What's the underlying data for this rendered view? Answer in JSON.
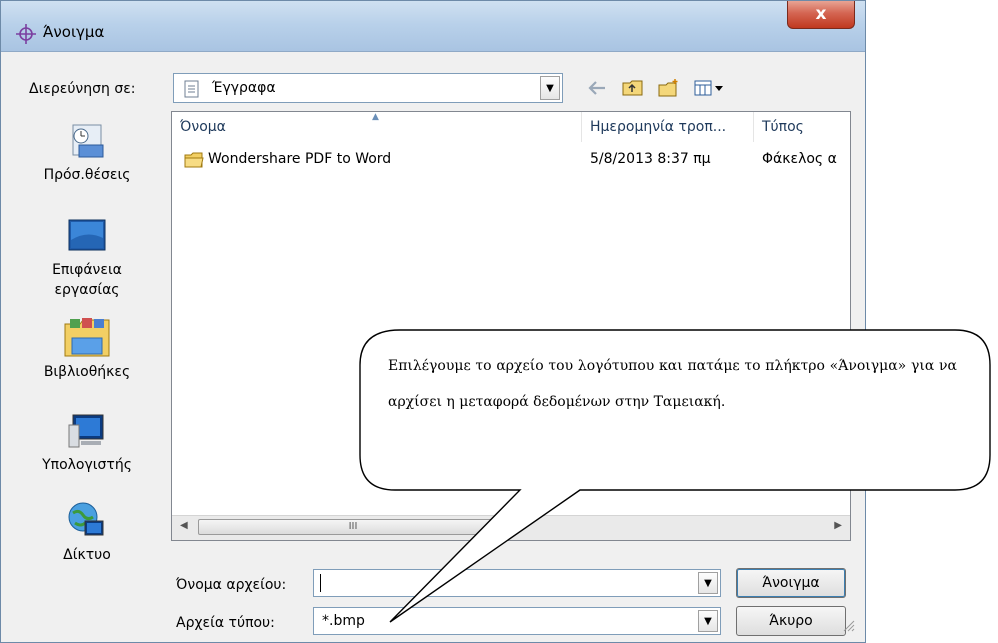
{
  "window": {
    "title": "Άνοιγμα",
    "close_glyph": "x",
    "close_icon": "close-icon",
    "title_icon": "crosshair-icon"
  },
  "lookin": {
    "label": "Διερεύνηση σε:",
    "value": "Έγγραφα",
    "icon": "document-folder-icon"
  },
  "toolbar": {
    "icons": [
      "back-arrow-icon",
      "up-folder-icon",
      "new-folder-icon",
      "view-menu-icon"
    ]
  },
  "places": [
    {
      "label": "Πρόσ.θέσεις",
      "icon": "recent-places-icon"
    },
    {
      "label": "Επιφάνεια εργασίας",
      "icon": "desktop-icon"
    },
    {
      "label": "Βιβλιοθήκες",
      "icon": "libraries-icon"
    },
    {
      "label": "Υπολογιστής",
      "icon": "computer-icon"
    },
    {
      "label": "Δίκτυο",
      "icon": "network-icon"
    }
  ],
  "filelist": {
    "columns": [
      "Όνομα",
      "Ημερομηνία τροπ...",
      "Τύπος"
    ],
    "rows": [
      {
        "name": "Wondershare PDF to Word",
        "date": "5/8/2013 8:37 πμ",
        "type": "Φάκελος α"
      }
    ],
    "scroll_thumb_text": "III"
  },
  "filename": {
    "label": "Όνομα αρχείου:",
    "value": ""
  },
  "filetype": {
    "label": "Αρχεία τύπου:",
    "value": "*.bmp"
  },
  "buttons": {
    "open": "Άνοιγμα",
    "cancel": "Άκυρο"
  },
  "callout": {
    "text": "Επιλέγουμε το αρχείο του λογότυπου  και πατάμε το πλήκτρο «Άνοιγμα» για να αρχίσει η μεταφορά δεδομένων στην Ταμειακή."
  },
  "colors": {
    "titlebar": "#b9d1ea",
    "close": "#c0381f",
    "window_bg": "#f0f0f0",
    "header_text": "#1e395b"
  }
}
